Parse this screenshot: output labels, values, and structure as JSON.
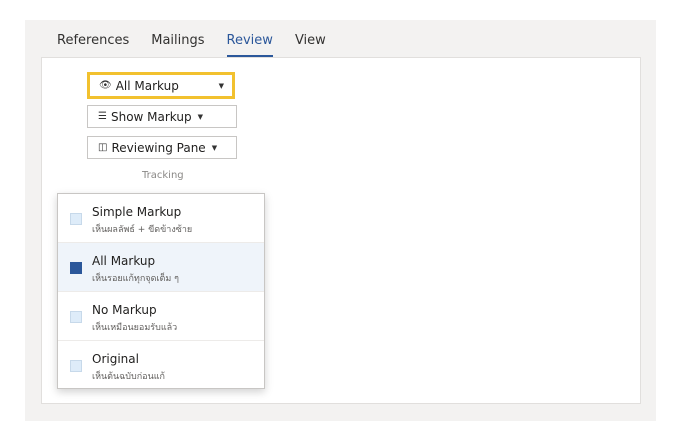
{
  "ribbon": {
    "tabs": [
      {
        "label": "References"
      },
      {
        "label": "Mailings"
      },
      {
        "label": "Review",
        "active": true
      },
      {
        "label": "View"
      }
    ]
  },
  "tracking": {
    "display_dropdown": {
      "icon": "eye-icon",
      "glyph": "👁",
      "label": "All Markup",
      "caret": "▼"
    },
    "show_markup": {
      "icon": "list-icon",
      "glyph": "☰",
      "label": "Show Markup",
      "caret": "▼"
    },
    "reviewing_pane": {
      "icon": "pane-icon",
      "glyph": "◫",
      "label": "Reviewing Pane",
      "caret": "▼"
    },
    "group_label": "Tracking"
  },
  "markup_menu": {
    "items": [
      {
        "title": "Simple Markup",
        "subtitle": "เห็นผลลัพธ์ + ขีดข้างซ้าย",
        "selected": false
      },
      {
        "title": "All Markup",
        "subtitle": "เห็นรอยแก้ทุกจุดเต็ม ๆ",
        "selected": true
      },
      {
        "title": "No Markup",
        "subtitle": "เห็นเหมือนยอมรับแล้ว",
        "selected": false
      },
      {
        "title": "Original",
        "subtitle": "เห็นต้นฉบับก่อนแก้",
        "selected": false
      }
    ]
  },
  "colors": {
    "accent": "#2b579a",
    "focus_ring": "#f2c12e"
  }
}
